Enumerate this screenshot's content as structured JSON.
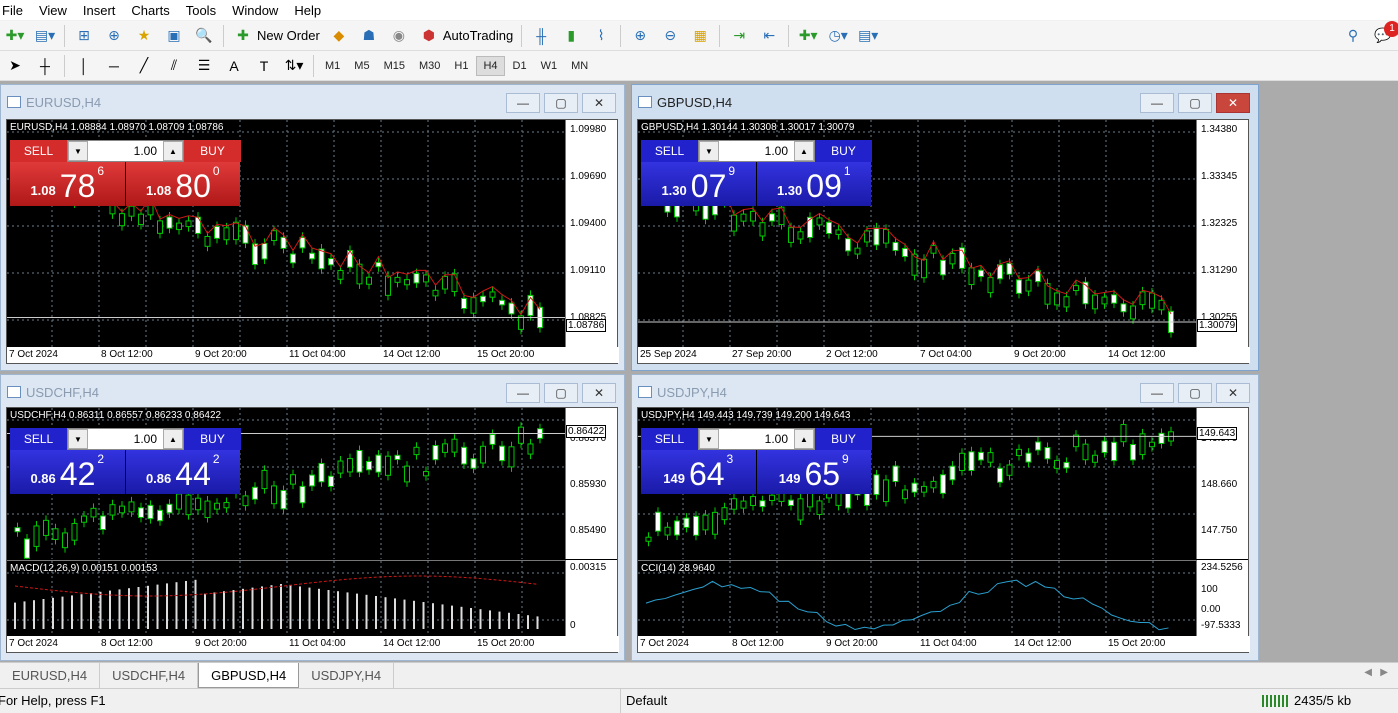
{
  "menu": [
    "File",
    "View",
    "Insert",
    "Charts",
    "Tools",
    "Window",
    "Help"
  ],
  "toolbar": {
    "new_order": "New Order",
    "autotrading": "AutoTrading",
    "notif_count": "1"
  },
  "timeframes": [
    "M1",
    "M5",
    "M15",
    "M30",
    "H1",
    "H4",
    "D1",
    "W1",
    "MN"
  ],
  "active_tf": "H4",
  "windows": [
    {
      "title": "EURUSD,H4",
      "info": "EURUSD,H4  1.08884 1.08970 1.08709 1.08786",
      "sell": "SELL",
      "buy": "BUY",
      "lot": "1.00",
      "bid_a": "1.08",
      "bid_b": "78",
      "bid_c": "6",
      "ask_a": "1.08",
      "ask_b": "80",
      "ask_c": "0",
      "yticks": [
        "1.09980",
        "1.09690",
        "1.09400",
        "1.09110",
        "1.08825"
      ],
      "cur": "1.08786",
      "xticks": [
        "7 Oct 2024",
        "8 Oct 12:00",
        "9 Oct 20:00",
        "11 Oct 04:00",
        "14 Oct 12:00",
        "15 Oct 20:00"
      ]
    },
    {
      "title": "GBPUSD,H4",
      "info": "GBPUSD,H4  1.30144 1.30308 1.30017 1.30079",
      "sell": "SELL",
      "buy": "BUY",
      "lot": "1.00",
      "bid_a": "1.30",
      "bid_b": "07",
      "bid_c": "9",
      "ask_a": "1.30",
      "ask_b": "09",
      "ask_c": "1",
      "yticks": [
        "1.34380",
        "1.33345",
        "1.32325",
        "1.31290",
        "1.30255"
      ],
      "cur": "1.30079",
      "xticks": [
        "25 Sep 2024",
        "27 Sep 20:00",
        "2 Oct 12:00",
        "7 Oct 04:00",
        "9 Oct 20:00",
        "14 Oct 12:00"
      ]
    },
    {
      "title": "USDCHF,H4",
      "info": "USDCHF,H4  0.86311 0.86557 0.86233 0.86422",
      "sell": "SELL",
      "buy": "BUY",
      "lot": "1.00",
      "bid_a": "0.86",
      "bid_b": "42",
      "bid_c": "2",
      "ask_a": "0.86",
      "ask_b": "44",
      "ask_c": "2",
      "yticks": [
        "0.86370",
        "0.85930",
        "0.85490"
      ],
      "cur": "0.86422",
      "ind": "MACD(12,26,9) 0.00151 0.00153",
      "ind_ticks": [
        "0.00315",
        "0"
      ],
      "xticks": [
        "7 Oct 2024",
        "8 Oct 12:00",
        "9 Oct 20:00",
        "11 Oct 04:00",
        "14 Oct 12:00",
        "15 Oct 20:00"
      ]
    },
    {
      "title": "USDJPY,H4",
      "info": "USDJPY,H4  149.443 149.739 149.200 149.643",
      "sell": "SELL",
      "buy": "BUY",
      "lot": "1.00",
      "bid_a": "149",
      "bid_b": "64",
      "bid_c": "3",
      "ask_a": "149",
      "ask_b": "65",
      "ask_c": "9",
      "yticks": [
        "149.570",
        "148.660",
        "147.750"
      ],
      "cur": "149.643",
      "ind": "CCI(14) 28.9640",
      "ind_ticks": [
        "234.5256",
        "100",
        "0.00",
        "-97.5333"
      ],
      "xticks": [
        "7 Oct 2024",
        "8 Oct 12:00",
        "9 Oct 20:00",
        "11 Oct 04:00",
        "14 Oct 12:00",
        "15 Oct 20:00"
      ]
    }
  ],
  "tabs": [
    "EURUSD,H4",
    "USDCHF,H4",
    "GBPUSD,H4",
    "USDJPY,H4"
  ],
  "active_tab": "GBPUSD,H4",
  "status": {
    "help": "For Help, press F1",
    "profile": "Default",
    "traffic": "2435/5 kb"
  }
}
